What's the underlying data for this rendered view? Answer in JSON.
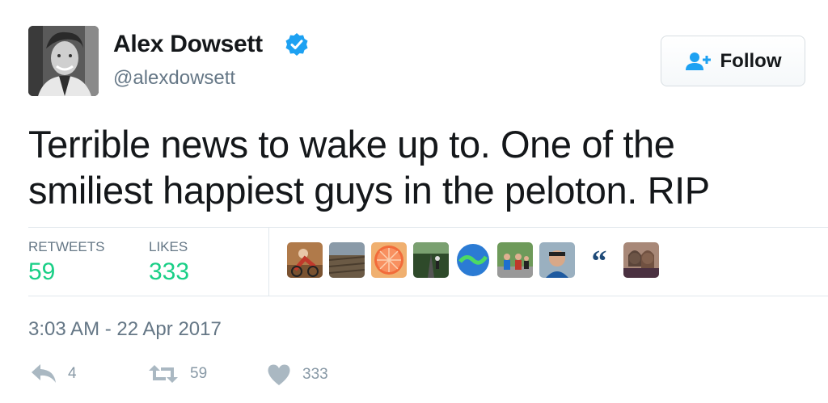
{
  "user": {
    "display_name": "Alex Dowsett",
    "handle": "@alexdowsett",
    "avatar_icon": "profile-photo",
    "verified_icon": "verified-badge-icon"
  },
  "follow_button": {
    "label": "Follow",
    "icon": "add-user-icon"
  },
  "tweet": {
    "text": "Terrible news to wake up to. One of the smiliest happiest guys in the peloton. RIP"
  },
  "stats": {
    "retweets_label": "RETWEETS",
    "retweets_value": "59",
    "likes_label": "LIKES",
    "likes_value": "333"
  },
  "likers": [
    {
      "name": "liker-avatar-cyclist"
    },
    {
      "name": "liker-avatar-landscape"
    },
    {
      "name": "liker-avatar-orange"
    },
    {
      "name": "liker-avatar-road"
    },
    {
      "name": "liker-avatar-globe"
    },
    {
      "name": "liker-avatar-group"
    },
    {
      "name": "liker-avatar-selfie"
    },
    {
      "name": "liker-avatar-quote"
    },
    {
      "name": "liker-avatar-friends"
    }
  ],
  "timestamp": "3:03 AM - 22 Apr 2017",
  "actions": {
    "reply_count": "4",
    "retweet_count": "59",
    "like_count": "333"
  },
  "colors": {
    "accent_green": "#19cf86",
    "secondary_text": "#657786",
    "verified_blue": "#1da1f2",
    "icon_gray": "#aab8c2"
  }
}
